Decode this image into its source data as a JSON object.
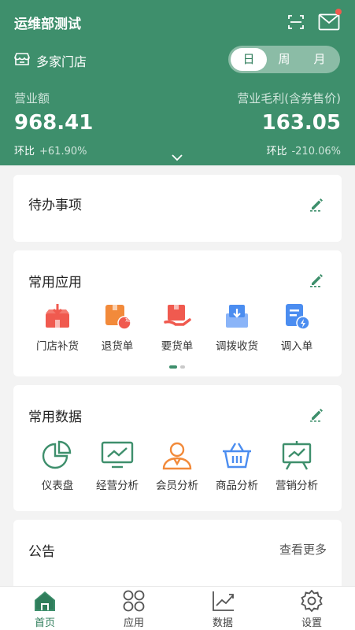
{
  "header": {
    "title": "运维部测试",
    "store_label": "多家门店",
    "period_options": [
      "日",
      "周",
      "月"
    ],
    "period_selected": "日",
    "revenue": {
      "label": "营业额",
      "value": "968.41",
      "mom_label": "环比",
      "mom_value": "+61.90%"
    },
    "gross_profit": {
      "label": "营业毛利(含券售价)",
      "value": "163.05",
      "mom_label": "环比",
      "mom_value": "-210.06%"
    }
  },
  "todo": {
    "title": "待办事项"
  },
  "apps": {
    "title": "常用应用",
    "items": [
      {
        "label": "门店补货",
        "icon": "store-replenish-icon"
      },
      {
        "label": "退货单",
        "icon": "return-order-icon",
        "badge": "退"
      },
      {
        "label": "要货单",
        "icon": "request-order-icon"
      },
      {
        "label": "调拨收货",
        "icon": "transfer-receive-icon"
      },
      {
        "label": "调入单",
        "icon": "transfer-in-icon"
      }
    ],
    "pager": {
      "current": 1,
      "total": 2
    }
  },
  "data_section": {
    "title": "常用数据",
    "items": [
      {
        "label": "仪表盘",
        "icon": "pie-chart-icon"
      },
      {
        "label": "经营分析",
        "icon": "monitor-chart-icon"
      },
      {
        "label": "会员分析",
        "icon": "member-icon"
      },
      {
        "label": "商品分析",
        "icon": "basket-icon"
      },
      {
        "label": "营销分析",
        "icon": "board-chart-icon"
      }
    ]
  },
  "notice": {
    "title": "公告",
    "more": "查看更多"
  },
  "tabbar": {
    "items": [
      {
        "label": "首页",
        "icon": "home-icon"
      },
      {
        "label": "应用",
        "icon": "apps-grid-icon"
      },
      {
        "label": "数据",
        "icon": "data-chart-icon"
      },
      {
        "label": "设置",
        "icon": "settings-icon"
      }
    ],
    "active": "首页"
  },
  "colors": {
    "primary": "#3e8f6c",
    "icon_red": "#f05a4f",
    "icon_orange": "#f28a3a",
    "icon_blue": "#4b8df0",
    "badge": "#f05a4f"
  }
}
